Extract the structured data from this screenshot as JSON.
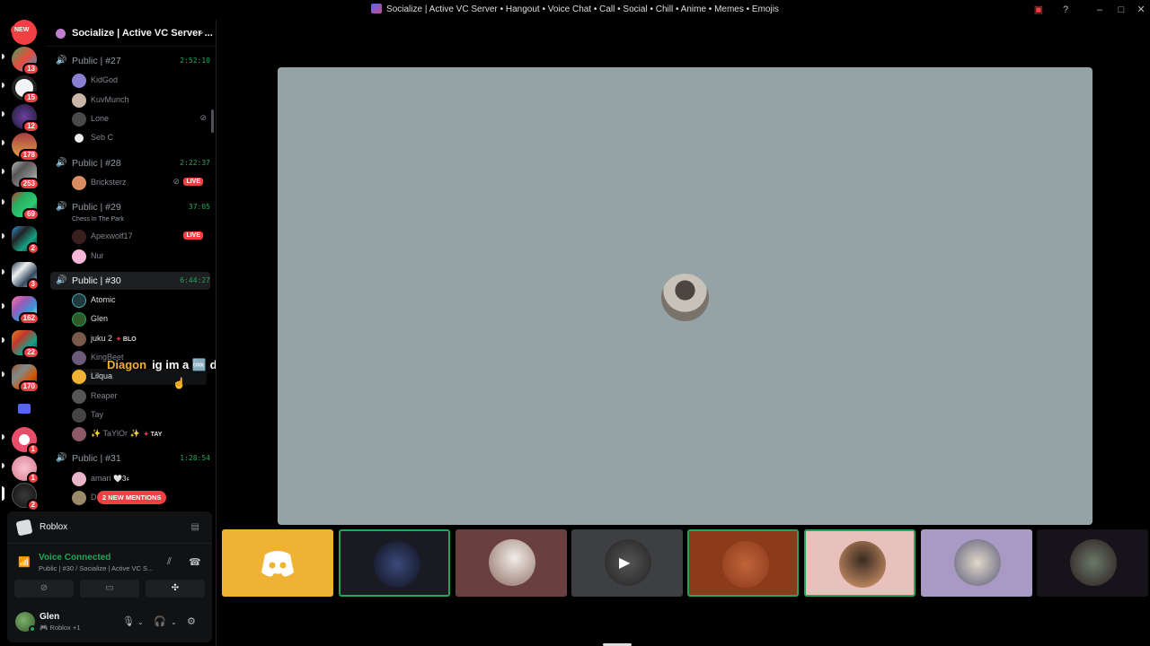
{
  "window": {
    "title": "Socialize | Active VC Server • Hangout • Voice Chat • Call • Social • Chill • Anime • Memes • Emojis"
  },
  "server_rail": {
    "new_label": "NEW",
    "badges": [
      "13",
      "15",
      "12",
      "178",
      "253",
      "69",
      "2",
      "3",
      "162",
      "22",
      "170",
      "1",
      "1",
      "2"
    ]
  },
  "server": {
    "name": "Socialize | Active VC Server ..."
  },
  "channels": [
    {
      "name": "Public | #27",
      "time": "2:52:10",
      "users": [
        "KidGod",
        "KuvMunch",
        "Lone",
        "Seb C"
      ]
    },
    {
      "name": "Public | #28",
      "time": "2:22:37",
      "users": [
        "Bricksterz"
      ],
      "live_label": "LIVE"
    },
    {
      "name": "Public | #29",
      "time": "37:05",
      "subtitle": "Chess In The Park",
      "users": [
        "Apexwolf17",
        "Nur"
      ],
      "live_label": "LIVE"
    },
    {
      "name": "Public | #30",
      "time": "6:44:27",
      "users": [
        "Atomic",
        "Glen",
        "juku 2",
        "KingBeet",
        "Lilqua",
        "Reaper",
        "Tay",
        "✨ TaYlOr ✨"
      ],
      "tags": {
        "juku": "BLO",
        "taylor": "TAY"
      }
    },
    {
      "name": "Public | #31",
      "time": "1:28:54",
      "users": [
        "amari",
        "D"
      ],
      "amari_suffix": "🤍ء3"
    }
  ],
  "mentions_label": "2 NEW MENTIONS",
  "overlay": {
    "speaker": "Diagon",
    "message": "ig im a 🆒 dork kid"
  },
  "activity": {
    "name": "Roblox"
  },
  "voice": {
    "status": "Voice Connected",
    "location": "Public | #30 / Socialize | Active VC S..."
  },
  "me": {
    "name": "Glen",
    "status": "🎮 Roblox +1"
  },
  "colors": {
    "accent_green": "#23a55a",
    "danger": "#f23f43",
    "blurple": "#5865f2"
  }
}
